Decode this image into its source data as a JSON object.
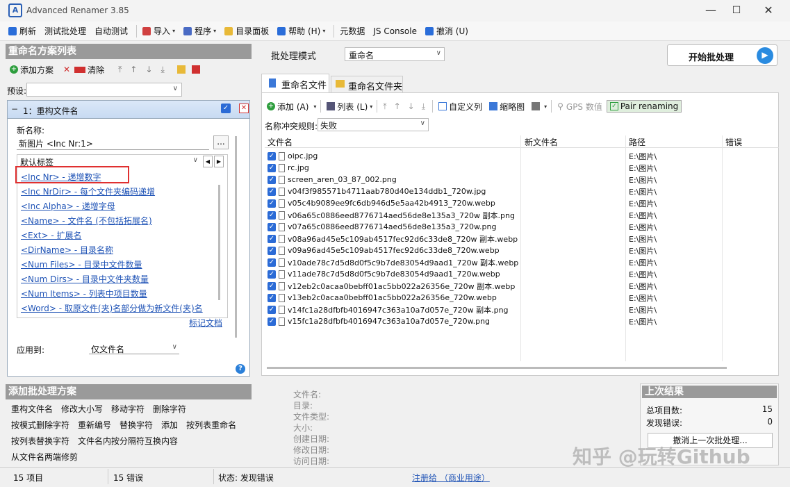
{
  "window": {
    "title": "Advanced Renamer 3.85",
    "min": "—",
    "max": "☐",
    "close": "✕"
  },
  "menu": [
    {
      "label": "刷新",
      "icon": "refresh-icon",
      "color": "#2a6dd9"
    },
    {
      "label": "测试批处理"
    },
    {
      "label": "自动测试"
    },
    {
      "label": "导入",
      "icon": "import-icon",
      "color": "#d04040",
      "caret": "▾"
    },
    {
      "label": "程序",
      "icon": "gear-icon",
      "color": "#4a6bc4",
      "caret": "▾"
    },
    {
      "label": "目录面板",
      "icon": "folder-icon",
      "color": "#e8b938"
    },
    {
      "label": "帮助 (H)",
      "icon": "help-icon",
      "color": "#2a6dd9",
      "caret": "▾"
    },
    {
      "label": "元数据"
    },
    {
      "label": "JS Console"
    },
    {
      "label": "撤消 (U)",
      "icon": "undo-icon",
      "color": "#2a6dd9"
    }
  ],
  "left": {
    "methods_title": "重命名方案列表",
    "add_method": "添加方案",
    "clear": "清除",
    "preset_label": "预设:",
    "method_name": "1：重构文件名",
    "new_name_label": "新名称:",
    "new_name_value": "新图片 <Inc Nr:1>",
    "browse": "...",
    "tags_select": "默认标签",
    "tags": [
      "<Inc Nr> - 递增数字",
      "<Inc NrDir> - 每个文件夹编码递增",
      "<Inc Alpha> - 递增字母",
      "<Name> - 文件名 (不包括拓展名)",
      "<Ext> - 扩展名",
      "<DirName> - 目录名称",
      "<Num Files> - 目录中文件数量",
      "<Num Dirs> - 目录中文件夹数量",
      "<Num Items> - 列表中项目数量",
      "<Word> - 取原文件(夹)名部分做为新文件(夹)名"
    ],
    "tag_docs": "标记文档",
    "apply_label": "应用到:",
    "apply_value": "仅文件名",
    "help_glyph": "?",
    "add_batch_title": "添加批处理方案",
    "batch_methods": [
      [
        "重构文件名",
        "修改大小写",
        "移动字符",
        "删除字符"
      ],
      [
        "按模式删除字符",
        "重新编号",
        "替换字符",
        "添加",
        "按列表重命名"
      ],
      [
        "按列表替换字符",
        "文件名内按分隔符互换内容"
      ],
      [
        "从文件名两端修剪"
      ]
    ]
  },
  "right": {
    "batch_mode_label": "批处理模式",
    "batch_mode_value": "重命名",
    "start_button": "开始批处理",
    "tabs": [
      "重命名文件",
      "重命名文件夹"
    ],
    "toolbar": {
      "add": "添加 (A)",
      "list": "列表 (L)",
      "custom_cols": "自定义列",
      "thumbnail": "缩略图",
      "gps": "GPS 数值",
      "pair": "Pair renaming"
    },
    "conflict_label": "名称冲突规则:",
    "conflict_value": "失败",
    "columns": [
      "文件名",
      "新文件名",
      "路径",
      "错误"
    ],
    "files": [
      {
        "name": "oipc.jpg",
        "path": "E:\\图片\\"
      },
      {
        "name": "rc.jpg",
        "path": "E:\\图片\\"
      },
      {
        "name": "screen_aren_03_87_002.png",
        "path": "E:\\图片\\"
      },
      {
        "name": "v04f3f985571b4711aab780d40e134ddb1_720w.jpg",
        "path": "E:\\图片\\"
      },
      {
        "name": "v05c4b9089ee9fc6db946d5e5aa42b4913_720w.webp",
        "path": "E:\\图片\\"
      },
      {
        "name": "v06a65c0886eed8776714aed56de8e135a3_720w 副本.png",
        "path": "E:\\图片\\"
      },
      {
        "name": "v07a65c0886eed8776714aed56de8e135a3_720w.png",
        "path": "E:\\图片\\"
      },
      {
        "name": "v08a96ad45e5c109ab4517fec92d6c33de8_720w 副本.webp",
        "path": "E:\\图片\\"
      },
      {
        "name": "v09a96ad45e5c109ab4517fec92d6c33de8_720w.webp",
        "path": "E:\\图片\\"
      },
      {
        "name": "v10ade78c7d5d8d0f5c9b7de83054d9aad1_720w 副本.webp",
        "path": "E:\\图片\\"
      },
      {
        "name": "v11ade78c7d5d8d0f5c9b7de83054d9aad1_720w.webp",
        "path": "E:\\图片\\"
      },
      {
        "name": "v12eb2c0acaa0bebff01ac5bb022a26356e_720w 副本.webp",
        "path": "E:\\图片\\"
      },
      {
        "name": "v13eb2c0acaa0bebff01ac5bb022a26356e_720w.webp",
        "path": "E:\\图片\\"
      },
      {
        "name": "v14fc1a28dfbfb4016947c363a10a7d057e_720w 副本.png",
        "path": "E:\\图片\\"
      },
      {
        "name": "v15fc1a28dfbfb4016947c363a10a7d057e_720w.png",
        "path": "E:\\图片\\"
      }
    ],
    "info_labels": [
      "文件名:",
      "目录:",
      "文件类型:",
      "大小:",
      "创建日期:",
      "修改日期:",
      "访问日期:"
    ],
    "last_result_title": "上次结果",
    "total_label": "总项目数:",
    "total_value": "15",
    "errors_label": "发现错误:",
    "errors_value": "0",
    "undo_last": "撤消上一次批处理..."
  },
  "status": {
    "items": "15 项目",
    "errors": "15 错误",
    "state": "状态: 发现错误",
    "registered": "注册给 （商业用途）"
  },
  "watermark": "知乎 @玩转Github"
}
